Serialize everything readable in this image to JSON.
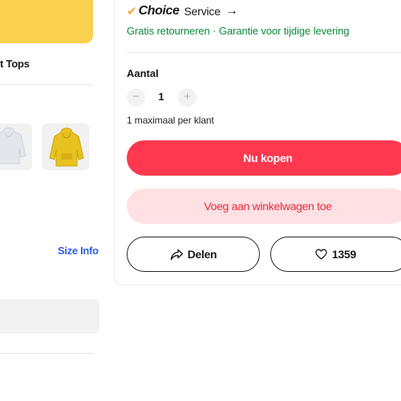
{
  "left": {
    "title": "t Tops",
    "size_info": "Size Info",
    "thumbnails": [
      {
        "name": "white-hoodie"
      },
      {
        "name": "yellow-hoodie"
      }
    ]
  },
  "product": {
    "choice": {
      "badge": "Choice",
      "service": "Service",
      "arrow": "→",
      "guarantees": "Gratis retourneren · Garantie voor tijdige levering"
    },
    "quantity": {
      "label": "Aantal",
      "minus": "−",
      "value": "1",
      "plus": "+",
      "limit_note": "1 maximaal per klant"
    },
    "actions": {
      "buy_now": "Nu kopen",
      "add_to_cart": "Voeg aan winkelwagen toe",
      "share": "Delen",
      "wishlist_count": "1359"
    }
  },
  "colors": {
    "accent": "#fd384f",
    "cart_bg": "#ffe1e3",
    "guarantee_green": "#0a8a3a",
    "link_blue": "#2e5fe0",
    "banner_yellow": "#fbd04f"
  }
}
